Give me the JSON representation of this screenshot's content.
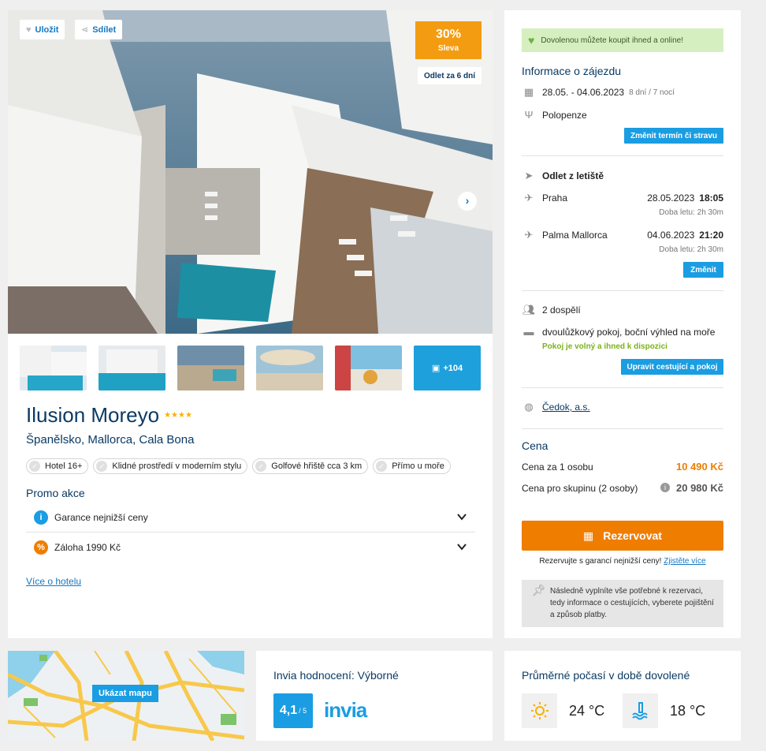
{
  "hero": {
    "save_label": "Uložit",
    "share_label": "Sdílet",
    "discount_pct": "30%",
    "discount_label": "Sleva",
    "departure_badge": "Odlet za 6 dní",
    "more_photos": "+104"
  },
  "hotel": {
    "name": "Ilusion Moreyo",
    "stars": "★★★★",
    "location": "Španělsko, Mallorca, Cala Bona",
    "tags": [
      "Hotel 16+",
      "Klidné prostředí v moderním stylu",
      "Golfové hřiště cca 3 km",
      "Přímo u moře"
    ],
    "promo_title": "Promo akce",
    "promos": [
      "Garance nejnižší ceny",
      "Záloha 1990 Kč"
    ],
    "more_link": "Více o hotelu"
  },
  "sidebar": {
    "availability": "Dovolenou můžete koupit ihned a online!",
    "info_title": "Informace o zájezdu",
    "dates": "28.05. - 04.06.2023",
    "dates_length": "8 dní / 7 nocí",
    "board": "Polopenze",
    "change_term_btn": "Změnit termín či stravu",
    "departure_title": "Odlet z letiště",
    "flights": [
      {
        "city": "Praha",
        "date": "28.05.2023",
        "time": "18:05",
        "duration": "Doba letu: 2h 30m"
      },
      {
        "city": "Palma Mallorca",
        "date": "04.06.2023",
        "time": "21:20",
        "duration": "Doba letu: 2h 30m"
      }
    ],
    "change_btn": "Změnit",
    "travelers": "2 dospělí",
    "room": "dvoulůžkový pokoj, boční výhled na moře",
    "room_status": "Pokoj je volný a ihned k dispozici",
    "edit_btn": "Upravit cestující a pokoj",
    "operator": "Čedok, a.s.",
    "price_title": "Cena",
    "price_per_person_label": "Cena za 1 osobu",
    "price_per_person": "10 490 Kč",
    "price_group_label": "Cena pro skupinu (2 osoby)",
    "price_group": "20 980 Kč",
    "reserve_btn": "Rezervovat",
    "guarantee_text": "Rezervujte s garancí nejnižší ceny!",
    "guarantee_link": "Zjistěte více",
    "info_note": "Následně vyplníte vše potřebné k rezervaci, tedy informace o cestujících, vyberete pojištění a způsob platby."
  },
  "map": {
    "button": "Ukázat mapu"
  },
  "rating": {
    "title": "Invia hodnocení: Výborné",
    "score": "4,1",
    "scale": "/ 5",
    "brand": "invia"
  },
  "weather": {
    "title": "Průměrné počasí v době dovolené",
    "air": "24 °C",
    "water": "18 °C"
  },
  "colors": {
    "accent": "#1a9de2",
    "orange": "#ef7d00",
    "navy": "#0a3a64"
  }
}
